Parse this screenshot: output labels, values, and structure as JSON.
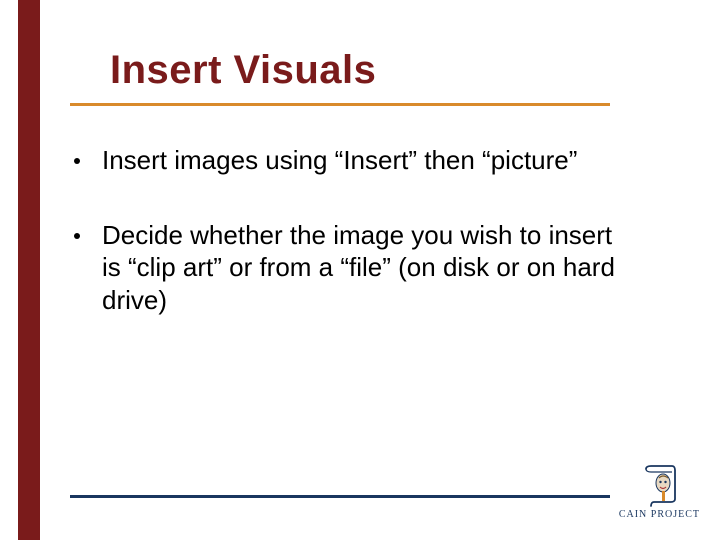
{
  "slide": {
    "title": "Insert Visuals",
    "bullets": [
      "Insert images using “Insert”  then “picture”",
      "Decide whether the image you wish to insert is “clip art” or from a “file” (on disk or on hard drive)"
    ]
  },
  "logo": {
    "text": "CAIN PROJECT"
  },
  "colors": {
    "accent_red": "#7a1b1b",
    "rule_orange": "#d98a2b",
    "rule_navy": "#19365f"
  }
}
